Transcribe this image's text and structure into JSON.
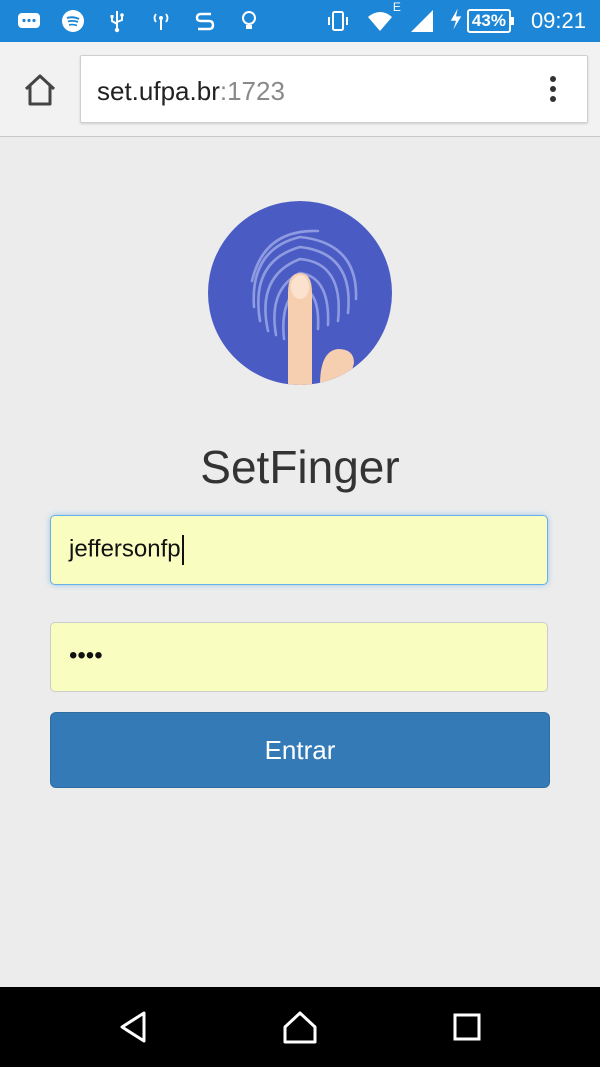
{
  "status_bar": {
    "battery_percent": "43%",
    "network_label": "E",
    "time": "09:21",
    "icons": [
      "message-icon",
      "spotify-icon",
      "usb-icon",
      "hotspot-icon",
      "s-icon",
      "bulb-icon",
      "vibrate-icon",
      "wifi-icon",
      "signal-icon",
      "charging-icon",
      "battery-icon"
    ]
  },
  "browser": {
    "url_host": "set.ufpa.br",
    "url_port": ":1723"
  },
  "app": {
    "title": "SetFinger",
    "username_value": "jeffersonfp",
    "password_masked": "••••",
    "login_label": "Entrar"
  },
  "colors": {
    "status_bar": "#1d86d6",
    "button": "#337ab7",
    "field_bg": "#fafdc0",
    "logo_circle": "#4a5cc4",
    "finger": "#f6cfb0"
  }
}
